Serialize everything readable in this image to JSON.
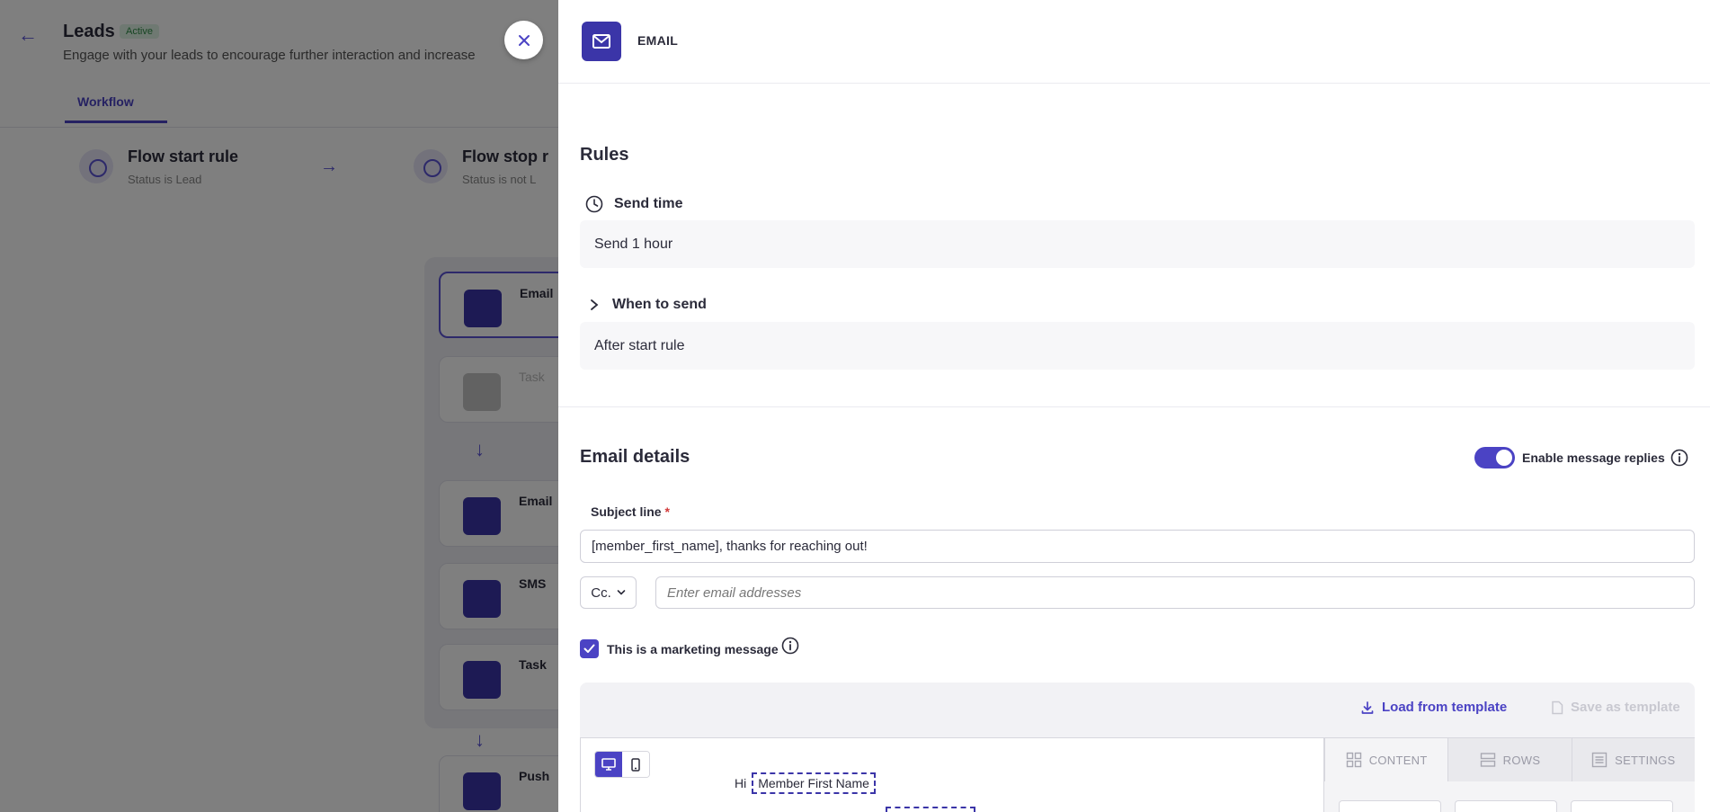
{
  "background": {
    "title": "Leads",
    "badge": "Active",
    "description": "Engage with your leads to encourage further interaction and increase",
    "tab": "Workflow",
    "start_rule": {
      "title": "Flow start rule",
      "subtitle": "Status is Lead"
    },
    "stop_rule": {
      "title": "Flow stop r",
      "subtitle": "Status is not L"
    },
    "steps": [
      "Email",
      "Task",
      "Email",
      "SMS",
      "Task",
      "Push"
    ]
  },
  "drawer": {
    "title": "EMAIL",
    "rules": {
      "heading": "Rules",
      "send_time_label": "Send time",
      "send_time_value": "Send 1 hour",
      "when_label": "When to send",
      "when_value": "After start rule"
    },
    "details": {
      "heading": "Email details",
      "replies_label": "Enable message replies",
      "replies_enabled": true,
      "subject_label": "Subject line",
      "required_mark": "*",
      "subject_value": "[member_first_name], thanks for reaching out!",
      "cc_label": "Cc.",
      "email_placeholder": "Enter email addresses",
      "marketing_label": "This is a marketing message",
      "marketing_checked": true
    },
    "editor": {
      "load_template": "Load from template",
      "save_template": "Save as template",
      "greeting": "Hi",
      "merge_tag": "Member First Name",
      "tabs": [
        "CONTENT",
        "ROWS",
        "SETTINGS"
      ]
    }
  },
  "colors": {
    "accent": "#4b43c4",
    "icon_bg": "#3b35a8",
    "overlay": "rgba(0,0,0,0.5)"
  }
}
